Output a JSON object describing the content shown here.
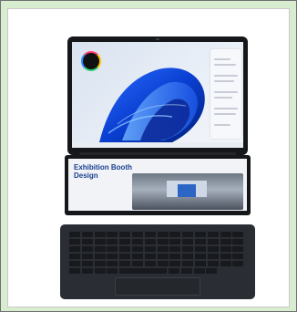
{
  "photo": {
    "description_icon": "laptop-dual-screen-icon",
    "lower_screen_title": "Exhibition Booth Design",
    "colors": {
      "background": "#d8eccf",
      "device": "#15171b",
      "accent": "#1a3f8f"
    }
  }
}
